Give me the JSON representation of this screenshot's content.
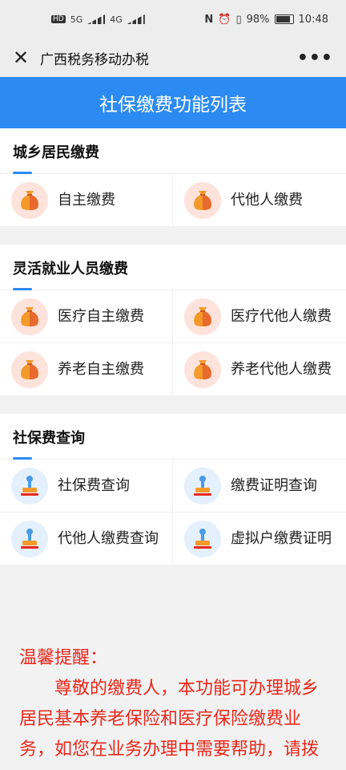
{
  "status": {
    "time": "10:48",
    "battery": "98%",
    "net1": "5G",
    "net2": "4G"
  },
  "nav": {
    "title": "广西税务移动办税",
    "more": "•••"
  },
  "banner": {
    "title": "社保缴费功能列表"
  },
  "sections": [
    {
      "title": "城乡居民缴费",
      "items": [
        {
          "label": "自主缴费",
          "icon": "money-bag-icon"
        },
        {
          "label": "代他人缴费",
          "icon": "money-bag-icon"
        }
      ]
    },
    {
      "title": "灵活就业人员缴费",
      "items": [
        {
          "label": "医疗自主缴费",
          "icon": "money-bag-icon"
        },
        {
          "label": "医疗代他人缴费",
          "icon": "money-bag-icon"
        },
        {
          "label": "养老自主缴费",
          "icon": "money-bag-icon"
        },
        {
          "label": "养老代他人缴费",
          "icon": "money-bag-icon"
        }
      ]
    },
    {
      "title": "社保费查询",
      "items": [
        {
          "label": "社保费查询",
          "icon": "stamp-icon"
        },
        {
          "label": "缴费证明查询",
          "icon": "stamp-icon"
        },
        {
          "label": "代他人缴费查询",
          "icon": "stamp-icon"
        },
        {
          "label": "虚拟户缴费证明",
          "icon": "stamp-icon"
        }
      ]
    }
  ],
  "tip": {
    "title": "温馨提醒：",
    "body": "尊敬的缴费人，本功能可办理城乡居民基本养老保险和医疗保险缴费业务，如您在业务办理中需要帮助，请拨打咨询服务电"
  },
  "colors": {
    "accent": "#2b8bf2",
    "tip": "#e8281c",
    "bag": "#f39a2b"
  }
}
